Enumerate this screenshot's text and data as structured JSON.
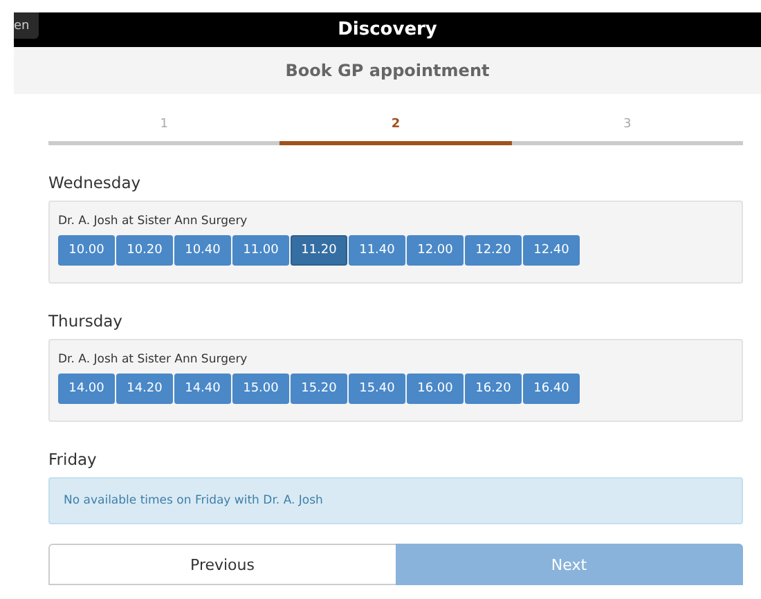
{
  "top_bar": {
    "back_button": "en",
    "title": "Discovery"
  },
  "header": {
    "title": "Book GP appointment"
  },
  "steps": [
    {
      "label": "1",
      "selected": false
    },
    {
      "label": "2",
      "selected": true
    },
    {
      "label": "3",
      "selected": false
    }
  ],
  "days": [
    {
      "kind": "slots",
      "day": "Wednesday",
      "clinician": "Dr. A. Josh at Sister Ann Surgery",
      "slots": [
        {
          "time": "10.00",
          "selected": false
        },
        {
          "time": "10.20",
          "selected": false
        },
        {
          "time": "10.40",
          "selected": false
        },
        {
          "time": "11.00",
          "selected": false
        },
        {
          "time": "11.20",
          "selected": true
        },
        {
          "time": "11.40",
          "selected": false
        },
        {
          "time": "12.00",
          "selected": false
        },
        {
          "time": "12.20",
          "selected": false
        },
        {
          "time": "12.40",
          "selected": false
        }
      ]
    },
    {
      "kind": "slots",
      "day": "Thursday",
      "clinician": "Dr. A. Josh at Sister Ann Surgery",
      "slots": [
        {
          "time": "14.00",
          "selected": false
        },
        {
          "time": "14.20",
          "selected": false
        },
        {
          "time": "14.40",
          "selected": false
        },
        {
          "time": "15.00",
          "selected": false
        },
        {
          "time": "15.20",
          "selected": false
        },
        {
          "time": "15.40",
          "selected": false
        },
        {
          "time": "16.00",
          "selected": false
        },
        {
          "time": "16.20",
          "selected": false
        },
        {
          "time": "16.40",
          "selected": false
        }
      ]
    },
    {
      "kind": "notice",
      "day": "Friday",
      "message": "No available times on Friday with Dr. A. Josh"
    }
  ],
  "buttons": [
    {
      "label": "Previous",
      "disabled": false
    },
    {
      "label": "Next",
      "disabled": true
    }
  ]
}
